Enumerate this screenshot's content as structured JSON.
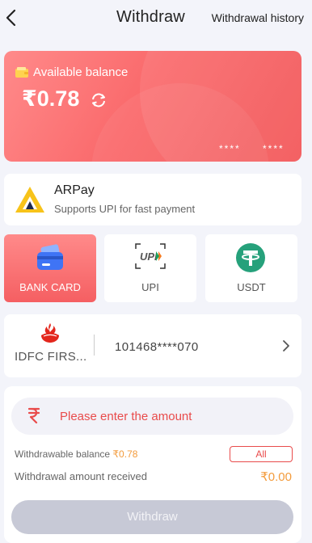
{
  "header": {
    "title": "Withdraw",
    "history_label": "Withdrawal history"
  },
  "balance": {
    "label": "Available balance",
    "amount": "₹0.78",
    "masked_1": "****",
    "masked_2": "****"
  },
  "provider": {
    "name": "ARPay",
    "subtitle": "Supports UPI for fast payment"
  },
  "methods": [
    {
      "label": "BANK CARD",
      "active": true
    },
    {
      "label": "UPI",
      "active": false
    },
    {
      "label": "USDT",
      "active": false
    }
  ],
  "bank_account": {
    "bank_name": "IDFC FIRS...",
    "account_number": "101468****070"
  },
  "amount_form": {
    "placeholder": "Please enter the amount",
    "withdrawable_label": "Withdrawable balance",
    "withdrawable_value": "₹0.78",
    "all_label": "All",
    "received_label": "Withdrawal amount received",
    "received_value": "₹0.00",
    "submit_label": "Withdraw"
  },
  "colors": {
    "accent": "#f25456",
    "amount_orange": "#f39b3c",
    "disabled_button": "#c7c9d6"
  }
}
